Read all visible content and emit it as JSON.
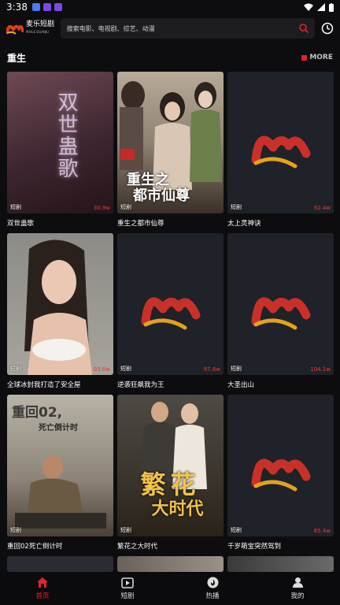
{
  "status": {
    "time": "3:38"
  },
  "header": {
    "logo_text": "麦乐短剧",
    "logo_sub": "MAILE DUANJU",
    "search_placeholder": "搜索电影、电视剧、综艺、动漫"
  },
  "section": {
    "title": "重生",
    "more_label": "MORE"
  },
  "cards": [
    {
      "title": "双世蛊歌",
      "type": "短剧",
      "hot": "30.9w",
      "art": "poster-text"
    },
    {
      "title": "重生之都市仙尊",
      "type": "短剧",
      "hot": "",
      "art": "poster-women"
    },
    {
      "title": "太上灵神诀",
      "type": "短剧",
      "hot": "92.4w",
      "art": "placeholder"
    },
    {
      "title": "全球冰封我打造了安全屋",
      "type": "短剧",
      "hot": "93.6w",
      "art": "poster-woman"
    },
    {
      "title": "逆袭狂飙我为王",
      "type": "短剧",
      "hot": "97.6w",
      "art": "placeholder"
    },
    {
      "title": "大圣出山",
      "type": "短剧",
      "hot": "104.1w",
      "art": "placeholder"
    },
    {
      "title": "重回02死亡倒计时",
      "type": "短剧",
      "hot": "",
      "art": "poster-man"
    },
    {
      "title": "繁花之大时代",
      "type": "短剧",
      "hot": "",
      "art": "poster-couple"
    },
    {
      "title": "千岁萌宝突然驾到",
      "type": "短剧",
      "hot": "85.4w",
      "art": "placeholder"
    }
  ],
  "poster_text": {
    "card1": "双世蛊歌",
    "card2_line1": "重生之",
    "card2_line2": "都市仙尊",
    "card7_line1": "重回02,",
    "card7_line2": "死亡倒计时",
    "card8_line1": "繁花",
    "card8_line2": "大时代"
  },
  "nav": [
    {
      "label": "首页",
      "icon": "home-icon",
      "active": true
    },
    {
      "label": "短剧",
      "icon": "play-icon",
      "active": false
    },
    {
      "label": "热播",
      "icon": "flame-icon",
      "active": false
    },
    {
      "label": "我的",
      "icon": "user-icon",
      "active": false
    }
  ],
  "colors": {
    "accent": "#e02525",
    "background": "#0d0d0f",
    "card": "#1f2228"
  }
}
